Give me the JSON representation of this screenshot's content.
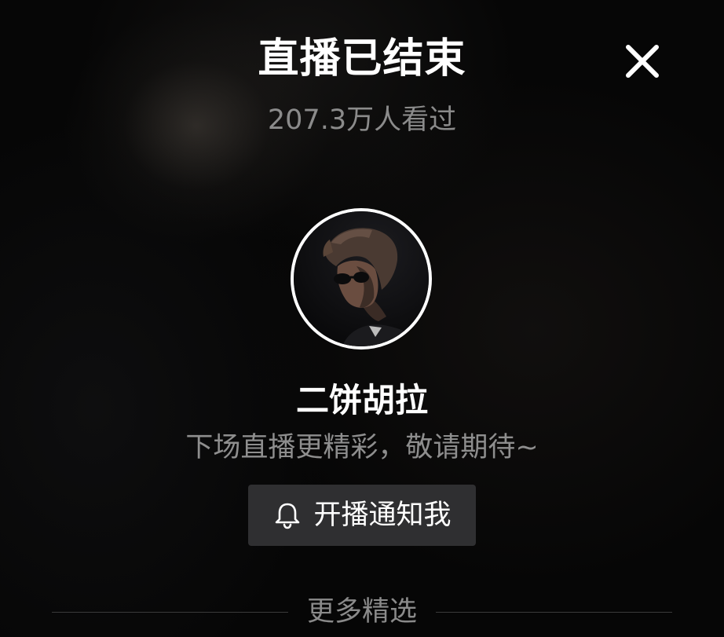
{
  "header": {
    "title": "直播已结束",
    "viewers": "207.3万人看过"
  },
  "streamer": {
    "name": "二饼胡拉",
    "message": "下场直播更精彩，敬请期待~"
  },
  "notify_button": {
    "label": "开播通知我",
    "icon": "bell-icon"
  },
  "more": {
    "label": "更多精选"
  },
  "icons": {
    "close": "close-icon",
    "bell": "bell-icon"
  },
  "colors": {
    "background": "#050505",
    "title": "#ffffff",
    "muted_text": "#8b8b8b",
    "button_bg": "#2f2f31",
    "divider": "#3a3a3a"
  }
}
